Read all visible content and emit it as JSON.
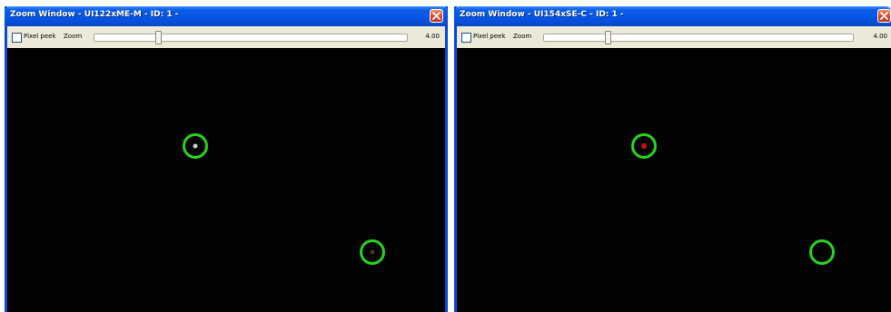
{
  "windows": [
    {
      "title": "Zoom Window - UI122xME-M - ID: 1 -",
      "pixel_peek_label": "Pixel peek",
      "pixel_peek_checked": false,
      "zoom_label": "Zoom",
      "zoom_value": "4.00",
      "zoom_slider_level": 0.2,
      "markers": [
        {
          "name": "marker-upper",
          "center_color": "#cfcfcf"
        },
        {
          "name": "marker-lower",
          "center_color": "#553030"
        }
      ]
    },
    {
      "title": "Zoom Window - UI154xSE-C - ID: 1 -",
      "pixel_peek_label": "Pixel peek",
      "pixel_peek_checked": false,
      "zoom_label": "Zoom",
      "zoom_value": "4.00",
      "zoom_slider_level": 0.2,
      "markers": [
        {
          "name": "marker-upper",
          "center_color": "#c81010"
        },
        {
          "name": "marker-lower",
          "center_color": "#020202"
        }
      ]
    }
  ],
  "colors": {
    "titlebar": "#0554e3",
    "marker_ring": "#27d41a",
    "viewport_background": "#020202",
    "close_button": "#d8482a"
  },
  "icons": {
    "close": "close-icon",
    "checkbox": "checkbox-icon"
  }
}
